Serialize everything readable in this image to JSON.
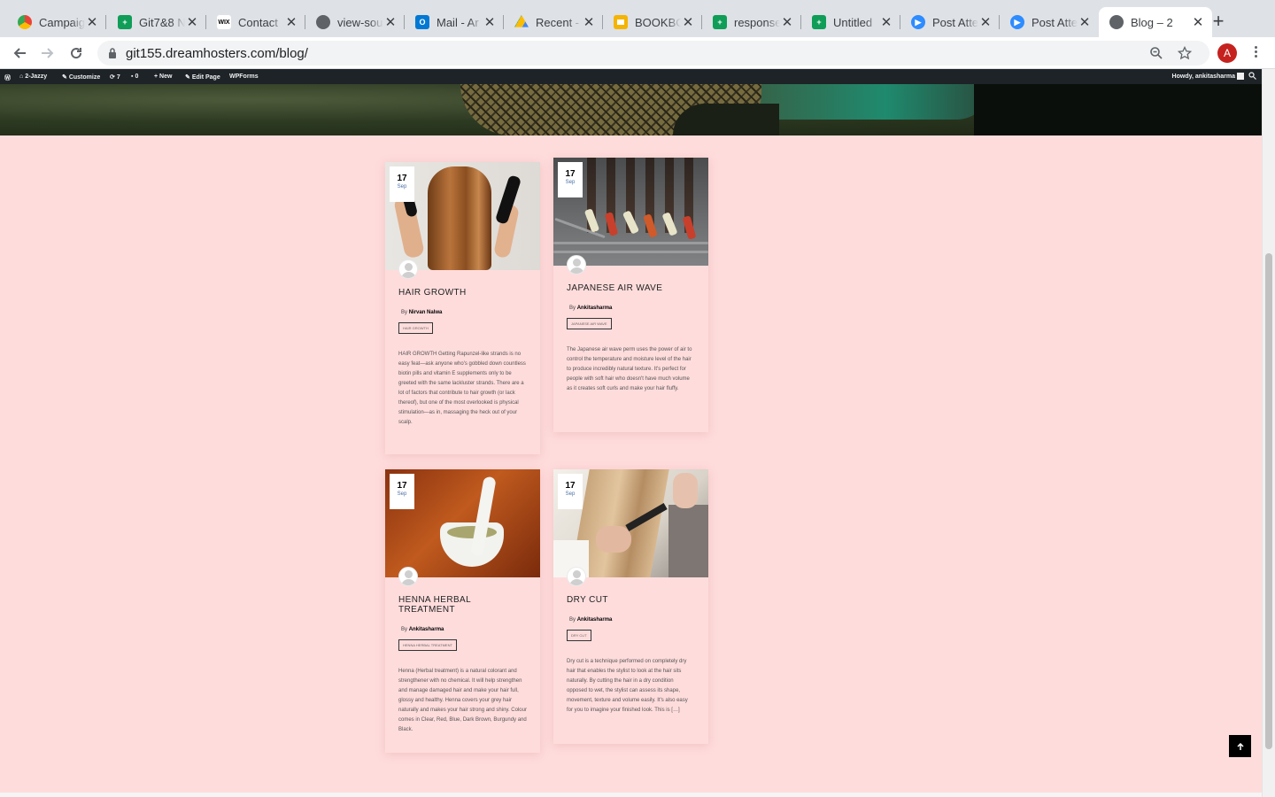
{
  "browser": {
    "tabs": [
      {
        "title": "Campaign",
        "icon": "chrome-icon",
        "color": "#fbbc04"
      },
      {
        "title": "Git7&8 N",
        "icon": "sheets-icon",
        "color": "#0f9d58"
      },
      {
        "title": "Contact",
        "icon": "wix-icon",
        "color": "#000000"
      },
      {
        "title": "view-sou",
        "icon": "globe-icon",
        "color": "#5f6368"
      },
      {
        "title": "Mail - Ar",
        "icon": "outlook-icon",
        "color": "#0078d4"
      },
      {
        "title": "Recent -",
        "icon": "drive-icon",
        "color": "#fbbc04"
      },
      {
        "title": "BOOKBO",
        "icon": "slides-icon",
        "color": "#f4b400"
      },
      {
        "title": "response",
        "icon": "sheets-icon",
        "color": "#0f9d58"
      },
      {
        "title": "Untitled",
        "icon": "sheets-icon",
        "color": "#0f9d58"
      },
      {
        "title": "Post Atte",
        "icon": "zoom-icon",
        "color": "#2d8cff"
      },
      {
        "title": "Post Atte",
        "icon": "zoom-icon",
        "color": "#2d8cff"
      },
      {
        "title": "Blog – 2",
        "icon": "globe-icon",
        "color": "#5f6368",
        "active": true
      }
    ],
    "url": "git155.dreamhosters.com/blog/",
    "profile_initial": "A"
  },
  "admin_bar": {
    "site_name": "2-Jazzy",
    "customize": "Customize",
    "updates": "7",
    "comments": "0",
    "new": "New",
    "edit_page": "Edit Page",
    "wpforms": "WPForms",
    "howdy": "Howdy, ankitasharma"
  },
  "posts": [
    {
      "day": "17",
      "month": "Sep",
      "title": "HAIR GROWTH",
      "by": "By",
      "author": "Nirvan Nalwa",
      "tag": "HAIR GROWTH",
      "excerpt": "HAIR GROWTH Getting Rapunzel-like strands is no easy feat—ask anyone who's gobbled down countless biotin pills and vitamin E supplements only to be greeted with the same lackluster strands. There are a lot of factors that contribute to hair growth (or lack thereof), but one of the most overlooked is physical stimulation—as in, massaging the heck out of your scalp."
    },
    {
      "day": "17",
      "month": "Sep",
      "title": "JAPANESE AIR WAVE",
      "by": "By",
      "author": "Ankitasharma",
      "tag": "JAPANESE AIR WAVE",
      "excerpt": "The Japanese air wave perm uses the power of air to control the temperature and moisture level of the hair to produce incredibly natural texture. It's perfect for people with soft hair who doesn't have much volume as it creates soft curls and make your hair fluffy."
    },
    {
      "day": "17",
      "month": "Sep",
      "title": "HENNA HERBAL TREATMENT",
      "by": "By",
      "author": "Ankitasharma",
      "tag": "HENNA HERBAL TREATMENT",
      "excerpt": "Henna (Herbal treatment) is a natural colorant and strengthener with no chemical. It will help strengthen and manage damaged hair and make your hair full, glossy and healthy. Henna covers your grey hair naturally and makes your hair strong and shiny. Colour comes in Clear, Red, Blue, Dark Brown, Burgundy and Black."
    },
    {
      "day": "17",
      "month": "Sep",
      "title": "DRY CUT",
      "by": "By",
      "author": "Ankitasharma",
      "tag": "DRY CUT",
      "excerpt": "Dry cut is a technique performed on completely dry hair that enables the stylist to look at the hair sits naturally. By cutting the hair in a dry condition opposed to wet, the stylist can assess its shape, movement, texture and volume easily. It's also easy for you to imagine your finished look. This is […]"
    }
  ]
}
